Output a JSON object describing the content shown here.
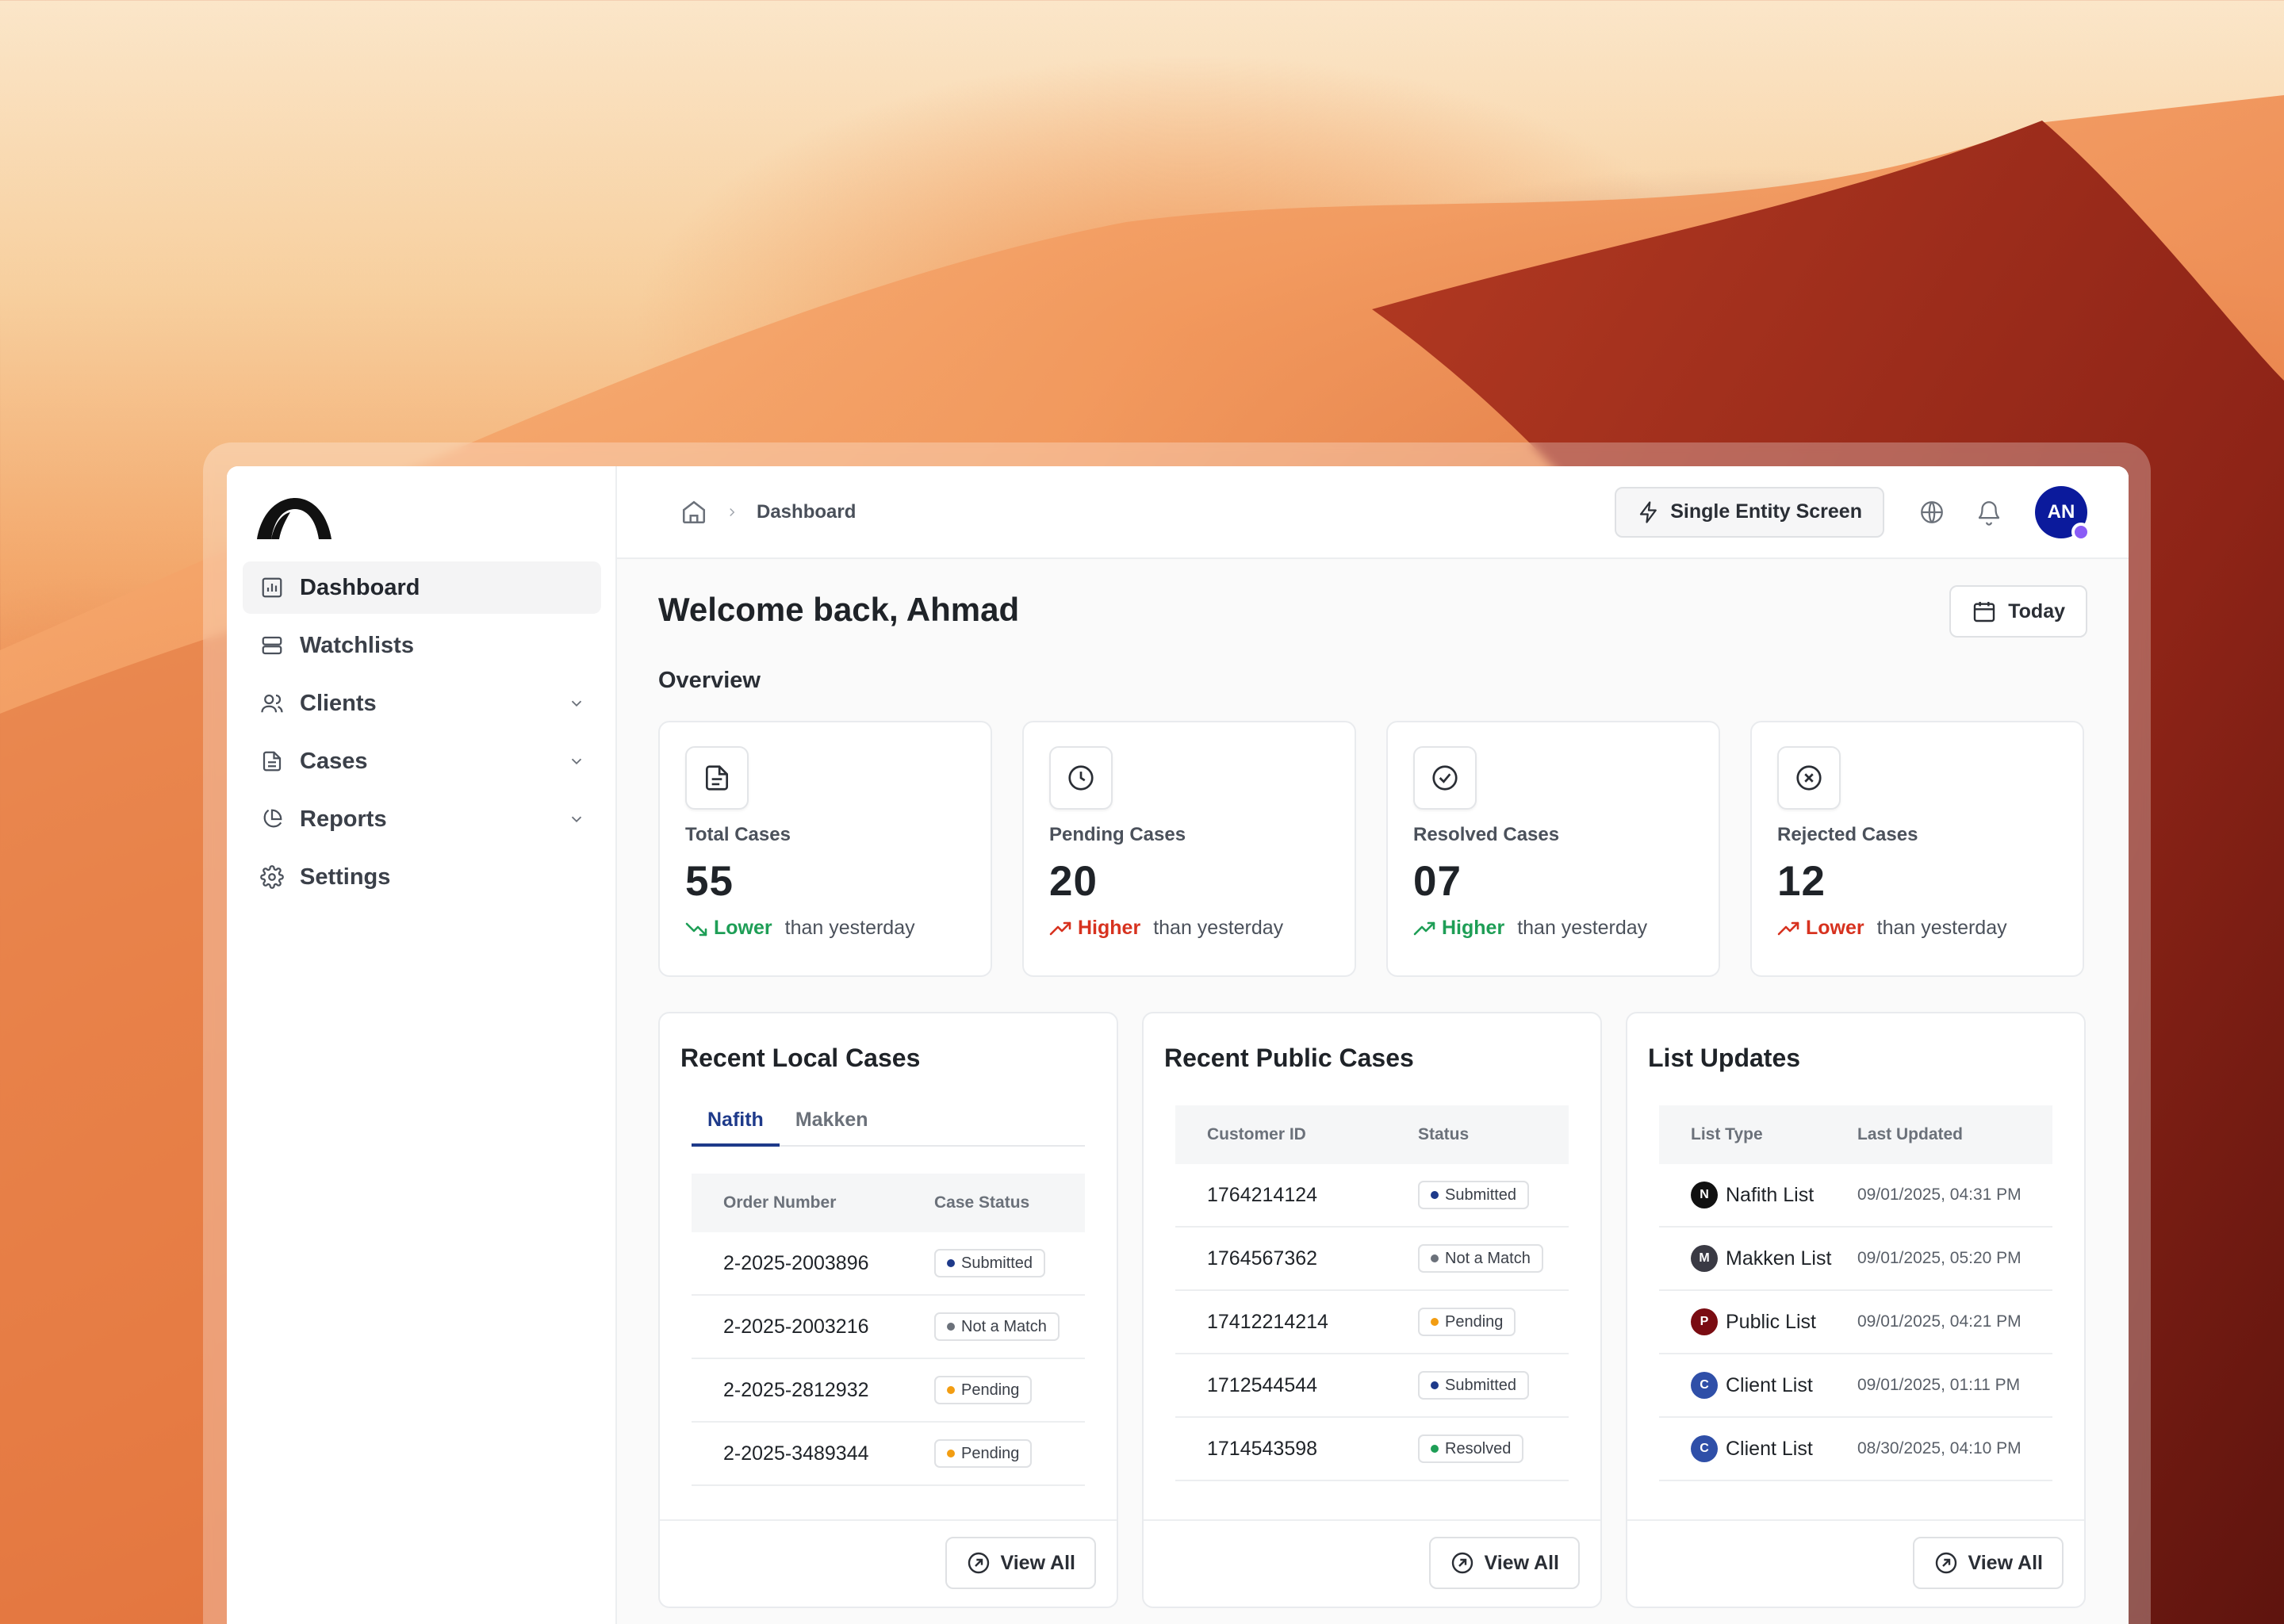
{
  "breadcrumb": {
    "current": "Dashboard"
  },
  "topbar": {
    "entity_button": "Single Entity Screen",
    "avatar_initials": "AN"
  },
  "sidebar": {
    "items": [
      {
        "label": "Dashboard",
        "icon": "bar-chart-icon",
        "active": true
      },
      {
        "label": "Watchlists",
        "icon": "server-icon"
      },
      {
        "label": "Clients",
        "icon": "users-icon",
        "expandable": true
      },
      {
        "label": "Cases",
        "icon": "file-text-icon",
        "expandable": true
      },
      {
        "label": "Reports",
        "icon": "pie-chart-icon",
        "expandable": true
      },
      {
        "label": "Settings",
        "icon": "gear-icon"
      }
    ]
  },
  "main": {
    "welcome": "Welcome back, Ahmad",
    "date_button": "Today",
    "overview_heading": "Overview",
    "stats": [
      {
        "title": "Total Cases",
        "value": "55",
        "trend_word": "Lower",
        "trend_rest": "than yesterday",
        "color": "#1e9e56",
        "direction": "down",
        "icon": "document-icon"
      },
      {
        "title": "Pending Cases",
        "value": "20",
        "trend_word": "Higher",
        "trend_rest": "than yesterday",
        "color": "#d7321f",
        "direction": "up",
        "icon": "clock-icon"
      },
      {
        "title": "Resolved Cases",
        "value": "07",
        "trend_word": "Higher",
        "trend_rest": "than yesterday",
        "color": "#1e9e56",
        "direction": "up",
        "icon": "check-circle-icon"
      },
      {
        "title": "Rejected Cases",
        "value": "12",
        "trend_word": "Lower",
        "trend_rest": "than yesterday",
        "color": "#d7321f",
        "direction": "up",
        "icon": "x-circle-icon"
      }
    ]
  },
  "local_cases": {
    "title": "Recent Local Cases",
    "tabs": [
      "Nafith",
      "Makken"
    ],
    "columns": [
      "Order Number",
      "Case Status"
    ],
    "rows": [
      {
        "order": "2-2025-2003896",
        "status": "Submitted",
        "dot": "#1e3a8a"
      },
      {
        "order": "2-2025-2003216",
        "status": "Not a Match",
        "dot": "#6b717a"
      },
      {
        "order": "2-2025-2812932",
        "status": "Pending",
        "dot": "#f29d12"
      },
      {
        "order": "2-2025-3489344",
        "status": "Pending",
        "dot": "#f29d12"
      }
    ],
    "view_all": "View All"
  },
  "public_cases": {
    "title": "Recent Public Cases",
    "columns": [
      "Customer ID",
      "Status"
    ],
    "rows": [
      {
        "id": "1764214124",
        "status": "Submitted",
        "dot": "#1e3a8a"
      },
      {
        "id": "1764567362",
        "status": "Not a Match",
        "dot": "#6b717a"
      },
      {
        "id": "17412214214",
        "status": "Pending",
        "dot": "#f29d12"
      },
      {
        "id": "1712544544",
        "status": "Submitted",
        "dot": "#1e3a8a"
      },
      {
        "id": "1714543598",
        "status": "Resolved",
        "dot": "#1e9e56"
      }
    ],
    "view_all": "View All"
  },
  "list_updates": {
    "title": "List Updates",
    "columns": [
      "List Type",
      "Last Updated"
    ],
    "rows": [
      {
        "letter": "N",
        "name": "Nafith List",
        "date": "09/01/2025, 04:31 PM",
        "color": "#111111"
      },
      {
        "letter": "M",
        "name": "Makken List",
        "date": "09/01/2025, 05:20 PM",
        "color": "#3a3a44"
      },
      {
        "letter": "P",
        "name": "Public List",
        "date": "09/01/2025, 04:21 PM",
        "color": "#7a0c12"
      },
      {
        "letter": "C",
        "name": "Client List",
        "date": "09/01/2025, 01:11 PM",
        "color": "#2f4fa8"
      },
      {
        "letter": "C",
        "name": "Client List",
        "date": "08/30/2025, 04:10 PM",
        "color": "#2f4fa8"
      }
    ],
    "view_all": "View All"
  }
}
